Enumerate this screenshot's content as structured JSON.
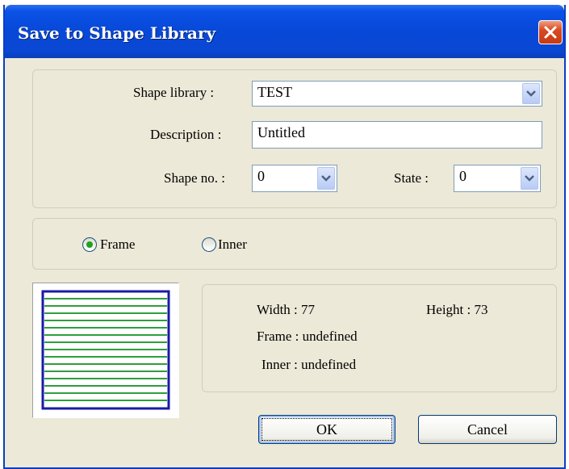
{
  "window": {
    "title": "Save to Shape Library"
  },
  "form": {
    "shape_library_label": "Shape library :",
    "shape_library_value": "TEST",
    "description_label": "Description :",
    "description_value": "Untitled",
    "shape_no_label": "Shape no. :",
    "shape_no_value": "0",
    "state_label": "State  :",
    "state_value": "0"
  },
  "options": {
    "frame_label": "Frame",
    "inner_label": "Inner",
    "selected": "Frame"
  },
  "info": {
    "width_label": "Width : 77",
    "height_label": "Height :  73",
    "frame_label": "Frame : undefined",
    "inner_label": "Inner : undefined"
  },
  "buttons": {
    "ok": "OK",
    "cancel": "Cancel"
  },
  "colors": {
    "title_bar": "#0a52e6",
    "close_button": "#d84a22",
    "dialog_bg": "#ece9d8",
    "preview_stripe": "#2e9e3e",
    "preview_border": "#1a1aa8",
    "radio_selected": "#21a121"
  },
  "icons": {
    "close": "close-icon",
    "dropdown": "chevron-down-icon"
  }
}
